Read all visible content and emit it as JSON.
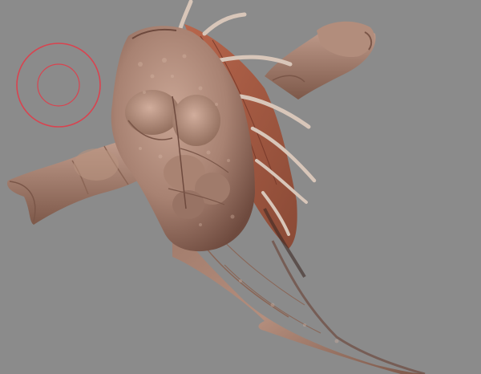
{
  "viewport": {
    "background_color": "#8b8b8b",
    "content": "sculpted-creature-model"
  },
  "brush_cursor": {
    "icon": "brush-radius-icon",
    "color": "#d9434f"
  },
  "model": {
    "skin_base": "#a88272",
    "skin_highlight": "#c9a594",
    "skin_shadow": "#6e4a3e",
    "fin_color": "#a75b45",
    "spine_color": "#d8c6b9"
  }
}
